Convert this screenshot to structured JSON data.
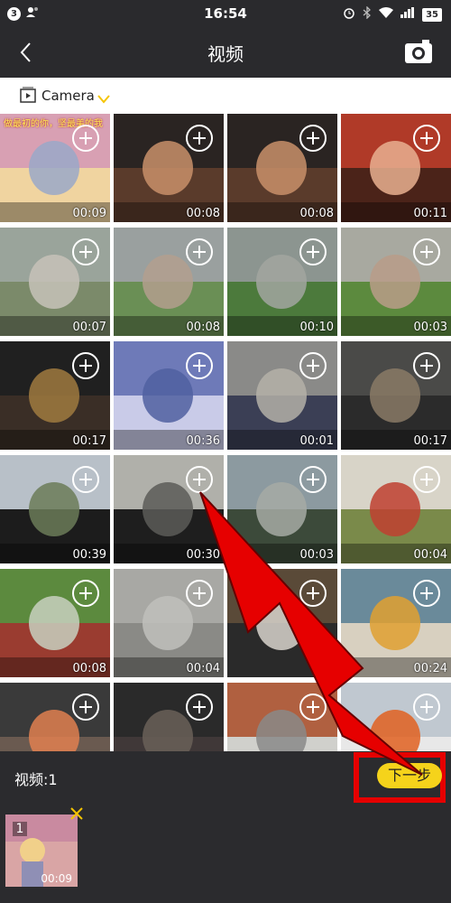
{
  "status_bar": {
    "notif_count": "3",
    "time": "16:54",
    "battery": "35"
  },
  "header": {
    "title": "视频",
    "back_icon": "back-chevron-icon",
    "camera_icon": "camera-icon"
  },
  "album": {
    "name": "Camera",
    "accent": "#f5c400"
  },
  "grid": {
    "items": [
      {
        "duration": "00:09",
        "caption": "做最初的你，坚最美的我"
      },
      {
        "duration": "00:08"
      },
      {
        "duration": "00:08"
      },
      {
        "duration": "00:11"
      },
      {
        "duration": "00:07"
      },
      {
        "duration": "00:08"
      },
      {
        "duration": "00:10"
      },
      {
        "duration": "00:03"
      },
      {
        "duration": "00:17"
      },
      {
        "duration": "00:36"
      },
      {
        "duration": "00:01"
      },
      {
        "duration": "00:17"
      },
      {
        "duration": "00:39"
      },
      {
        "duration": "00:30"
      },
      {
        "duration": "00:03"
      },
      {
        "duration": "00:04"
      },
      {
        "duration": "00:08"
      },
      {
        "duration": "00:04"
      },
      {
        "duration": ""
      },
      {
        "duration": "00:24"
      },
      {
        "duration": ""
      },
      {
        "duration": ""
      },
      {
        "duration": ""
      },
      {
        "duration": ""
      }
    ]
  },
  "bottom": {
    "count_label": "视频:1",
    "next_label": "下一步",
    "next_color": "#f5d31b",
    "highlight_color": "#e60000",
    "selected": {
      "index": "1",
      "duration": "00:09"
    }
  }
}
